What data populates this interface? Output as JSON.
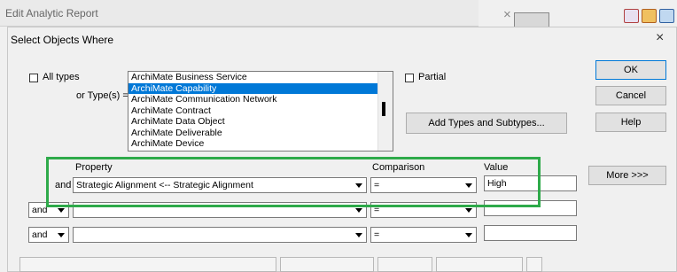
{
  "background_window": {
    "title": "Edit Analytic Report",
    "close_glyph": "×"
  },
  "dialog": {
    "title": "Select Objects Where",
    "close_glyph": "×",
    "all_types_label": "All types",
    "or_types_label": "or Type(s) =",
    "partial_label": "Partial",
    "type_list": [
      "ArchiMate Business Service",
      "ArchiMate Capability",
      "ArchiMate Communication Network",
      "ArchiMate Contract",
      "ArchiMate Data Object",
      "ArchiMate Deliverable",
      "ArchiMate Device"
    ],
    "selected_type": "ArchiMate Capability",
    "add_types_button": "Add Types and Subtypes...",
    "buttons": {
      "ok": "OK",
      "cancel": "Cancel",
      "help": "Help",
      "more": "More >>>"
    },
    "columns": {
      "property": "Property",
      "comparison": "Comparison",
      "value": "Value"
    },
    "rows": [
      {
        "connector": "and",
        "property": "Strategic Alignment <-- Strategic Alignment",
        "comparison": "=",
        "value": "High"
      },
      {
        "connector": "and",
        "property": "",
        "comparison": "=",
        "value": ""
      },
      {
        "connector": "and",
        "property": "",
        "comparison": "=",
        "value": ""
      }
    ],
    "highlight_color": "#2eaa4a",
    "selection_color": "#0078d7"
  }
}
